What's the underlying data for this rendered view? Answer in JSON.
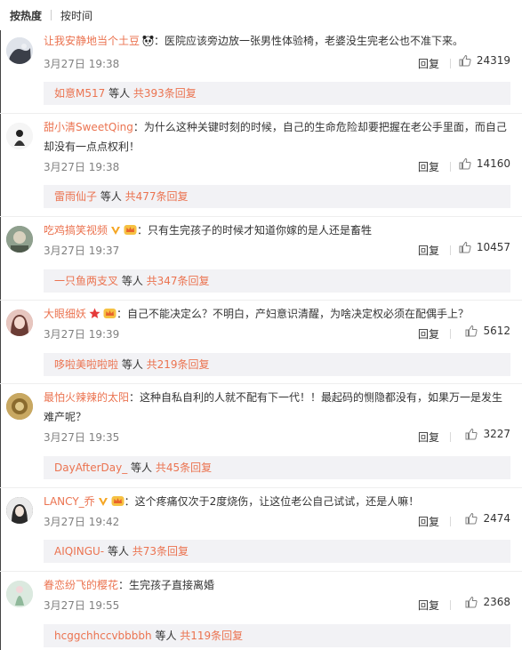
{
  "sort_tabs": {
    "hot": "按热度",
    "time": "按时间"
  },
  "comments": [
    {
      "user": "让我安静地当个土豆",
      "badges": [
        "panda-emoji"
      ],
      "text": "：医院应该旁边放一张男性体验椅，老婆没生完老公也不准下来。",
      "time": "3月27日 19:38",
      "reply": "回复",
      "likes": "24319",
      "sub_user": "如意M517",
      "sub_mid": " 等人 ",
      "sub_count": "共393条回复",
      "avatar_color": "#d8dde6"
    },
    {
      "user": "甜小清SweetQing",
      "badges": [],
      "text": "：为什么这种关键时刻的时候，自己的生命危险却要把握在老公手里面，而自己却没有一点点权利！",
      "time": "3月27日 19:38",
      "reply": "回复",
      "likes": "14160",
      "sub_user": "雷雨仙子",
      "sub_mid": " 等人 ",
      "sub_count": "共477条回复",
      "avatar_color": "#f3f3f3"
    },
    {
      "user": "吃鸡搞笑视频",
      "badges": [
        "verified-v-icon",
        "vip-crown-icon"
      ],
      "text": "：只有生完孩子的时候才知道你嫁的是人还是畜牲",
      "time": "3月27日 19:37",
      "reply": "回复",
      "likes": "10457",
      "sub_user": "一只鱼两支叉",
      "sub_mid": " 等人 ",
      "sub_count": "共347条回复",
      "avatar_color": "#7a8b7a"
    },
    {
      "user": "大眼细妖",
      "badges": [
        "star-icon",
        "vip-crown-icon"
      ],
      "text": "：自己不能决定么？不明白，产妇意识清醒，为啥决定权必须在配偶手上？",
      "time": "3月27日 19:39",
      "reply": "回复",
      "likes": "5612",
      "sub_user": "哆啦美啦啦啦",
      "sub_mid": " 等人 ",
      "sub_count": "共219条回复",
      "avatar_color": "#c98e8e"
    },
    {
      "user": "最怕火辣辣的太阳",
      "badges": [],
      "text": "：这种自私自利的人就不配有下一代！！最起码的恻隐都没有，如果万一是发生难产呢？",
      "time": "3月27日 19:35",
      "reply": "回复",
      "likes": "3227",
      "sub_user": "DayAfterDay_",
      "sub_mid": " 等人 ",
      "sub_count": "共45条回复",
      "avatar_color": "#b59a5a"
    },
    {
      "user": "LANCY_乔",
      "badges": [
        "verified-v-icon",
        "vip-crown-icon"
      ],
      "text": "：这个疼痛仅次于2度烧伤，让这位老公自己试试，还是人嘛！",
      "time": "3月27日 19:42",
      "reply": "回复",
      "likes": "2474",
      "sub_user": "AIQINGU-",
      "sub_mid": " 等人 ",
      "sub_count": "共73条回复",
      "avatar_color": "#555555"
    },
    {
      "user": "眷恋纷飞的樱花",
      "badges": [],
      "text": "：生完孩子直接离婚",
      "time": "3月27日 19:55",
      "reply": "回复",
      "likes": "2368",
      "sub_user": "hcggchhccvbbbbh",
      "sub_mid": " 等人 ",
      "sub_count": "共119条回复",
      "avatar_color": "#cfe3d4"
    }
  ]
}
